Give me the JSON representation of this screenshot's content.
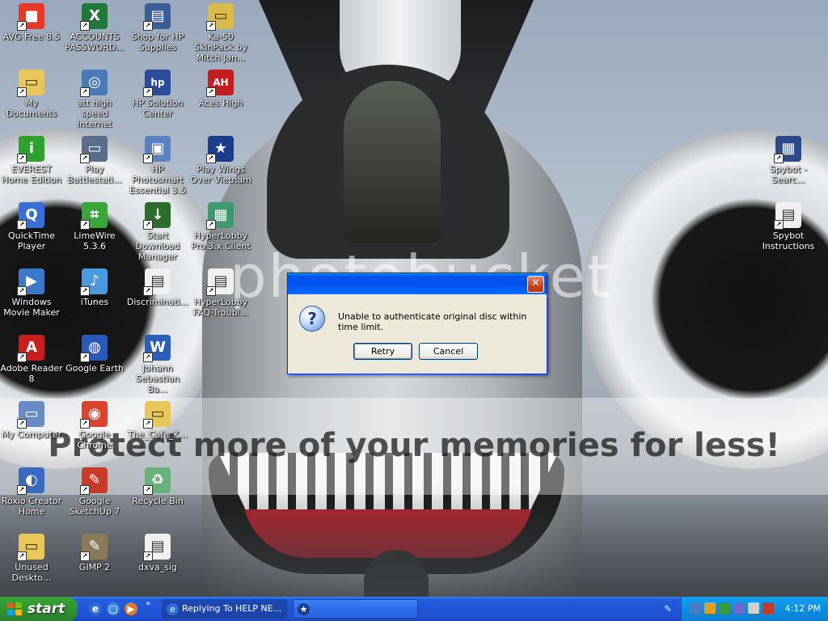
{
  "desktop_icons": [
    {
      "name": "avg-free-icon",
      "label": "AVG Free 8.5",
      "color": "#e53a2a",
      "glyph": "■"
    },
    {
      "name": "accounts-passwords-icon",
      "label": "ACCOUNTS PASSWORD...",
      "color": "#1f7a3a",
      "glyph": "X"
    },
    {
      "name": "hp-supplies-icon",
      "label": "Shop for HP Supplies",
      "color": "#3b5e98",
      "glyph": "▤"
    },
    {
      "name": "ka50-skinpack-icon",
      "label": "Ka-50 SkinPack by Mitch Jan...",
      "color": "#d8b94a",
      "glyph": "▭"
    },
    {
      "name": "my-documents-icon",
      "label": "My Documents",
      "color": "#e8c65a",
      "glyph": "▭"
    },
    {
      "name": "att-internet-icon",
      "label": "att high speed internet",
      "color": "#4a7ab8",
      "glyph": "◎"
    },
    {
      "name": "hp-solution-center-icon",
      "label": "HP Solution Center",
      "color": "#2c4c9a",
      "glyph": "hp"
    },
    {
      "name": "aces-high-icon",
      "label": "Aces High",
      "color": "#c21e1e",
      "glyph": "AH"
    },
    {
      "name": "everest-icon",
      "label": "EVEREST Home Edition",
      "color": "#2ea02e",
      "glyph": "i"
    },
    {
      "name": "play-battlestations-icon",
      "label": "Play Battlestati...",
      "color": "#5a6d8a",
      "glyph": "▭"
    },
    {
      "name": "hp-photosmart-icon",
      "label": "HP Photosmart Essential 3.5",
      "color": "#5b7fbf",
      "glyph": "▣"
    },
    {
      "name": "wings-vietnam-icon",
      "label": "Play Wings Over Vietnam",
      "color": "#1c3c8c",
      "glyph": "★"
    },
    {
      "name": "quicktime-icon",
      "label": "QuickTime Player",
      "color": "#3a6fd8",
      "glyph": "Q"
    },
    {
      "name": "limewire-icon",
      "label": "LimeWire 5.3.6",
      "color": "#3aa63a",
      "glyph": "⌗"
    },
    {
      "name": "start-download-manager-icon",
      "label": "Start Download Manager",
      "color": "#2c6d2c",
      "glyph": "↓"
    },
    {
      "name": "hyperlobby-client-icon",
      "label": "HyperLobby Pro 3.x Client",
      "color": "#3e9a6e",
      "glyph": "▦"
    },
    {
      "name": "windows-movie-maker-icon",
      "label": "Windows Movie Maker",
      "color": "#3c78c8",
      "glyph": "▶"
    },
    {
      "name": "itunes-icon",
      "label": "iTunes",
      "color": "#4a9ae0",
      "glyph": "♪"
    },
    {
      "name": "discrimination-doc-icon",
      "label": "Discriminati...",
      "color": "#f0f0f0",
      "glyph": "▤"
    },
    {
      "name": "hyperlobby-faq-icon",
      "label": "HyperLobby FAQ-Troubl...",
      "color": "#f0f0f0",
      "glyph": "▤"
    },
    {
      "name": "adobe-reader-icon",
      "label": "Adobe Reader 8",
      "color": "#c81e1e",
      "glyph": "A"
    },
    {
      "name": "google-earth-icon",
      "label": "Google Earth",
      "color": "#2a5ab8",
      "glyph": "◍"
    },
    {
      "name": "johann-bach-doc-icon",
      "label": "Johann Sebastian Ba...",
      "color": "#2b5fb8",
      "glyph": "W"
    },
    {
      "name": "my-computer-icon",
      "label": "My Computer",
      "color": "#6a8ac4",
      "glyph": "▭"
    },
    {
      "name": "google-chrome-icon",
      "label": "Google Chrome",
      "color": "#d8442c",
      "glyph": "◉"
    },
    {
      "name": "cafe-folder-icon",
      "label": "The_Cafe_K...",
      "color": "#e8c65a",
      "glyph": "▭"
    },
    {
      "name": "roxio-creator-icon",
      "label": "Roxio Creator Home",
      "color": "#3a6ac0",
      "glyph": "◐"
    },
    {
      "name": "sketchup-icon",
      "label": "Google SketchUp 7",
      "color": "#c83a2a",
      "glyph": "✎"
    },
    {
      "name": "recycle-bin-icon",
      "label": "Recycle Bin",
      "color": "#6ab07a",
      "glyph": "♻"
    },
    {
      "name": "unused-desktop-icon",
      "label": "Unused Deskto...",
      "color": "#e8c65a",
      "glyph": "▭"
    },
    {
      "name": "gimp-icon",
      "label": "GIMP 2",
      "color": "#8a7a5a",
      "glyph": "✎"
    },
    {
      "name": "dxva-sig-icon",
      "label": "dxva_sig",
      "color": "#f0f0f0",
      "glyph": "▤"
    },
    {
      "name": "spybot-search-icon",
      "label": "Spybot - Searc...",
      "color": "#2a4a8a",
      "glyph": "▦"
    },
    {
      "name": "spybot-instructions-icon",
      "label": "Spybot Instructions",
      "color": "#f0f0f0",
      "glyph": "▤"
    }
  ],
  "wallpaper": {
    "watermark": "photobucket",
    "promo": "Protect more of your memories for less!"
  },
  "dialog": {
    "close_glyph": "✕",
    "icon_glyph": "?",
    "message": "Unable to authenticate original disc within time limit.",
    "retry_label": "Retry",
    "cancel_label": "Cancel"
  },
  "taskbar": {
    "start_label": "start",
    "quick_launch_more": "»",
    "tasks": [
      {
        "label": "Replying To HELP NE...",
        "icon": "e"
      },
      {
        "label": "",
        "icon": "★"
      }
    ],
    "clock": "4:12 PM"
  }
}
